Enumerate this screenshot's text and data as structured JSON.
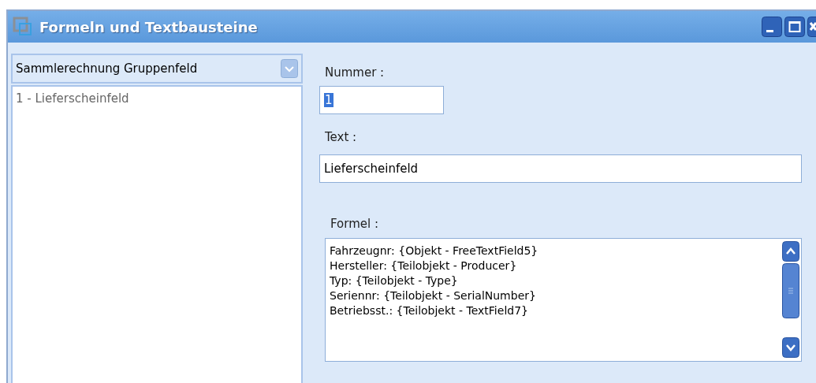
{
  "window": {
    "title": "Formeln und Textbausteine"
  },
  "category_select": {
    "value": "Sammlerechnung Gruppenfeld"
  },
  "list": {
    "items": [
      {
        "label": "1 - Lieferscheinfeld"
      }
    ]
  },
  "nummer": {
    "label": "Nummer :",
    "value": "1",
    "value_highlighted": true
  },
  "text": {
    "label": "Text :",
    "value": "Lieferscheinfeld"
  },
  "formel": {
    "label": "Formel :",
    "lines": [
      "Fahrzeugnr: {Objekt - FreeTextField5}",
      "Hersteller: {Teilobjekt - Producer}",
      "Typ: {Teilobjekt - Type}",
      "Seriennr: {Teilobjekt - SerialNumber}",
      "Betriebsst.: {Teilobjekt - TextField7}"
    ]
  }
}
